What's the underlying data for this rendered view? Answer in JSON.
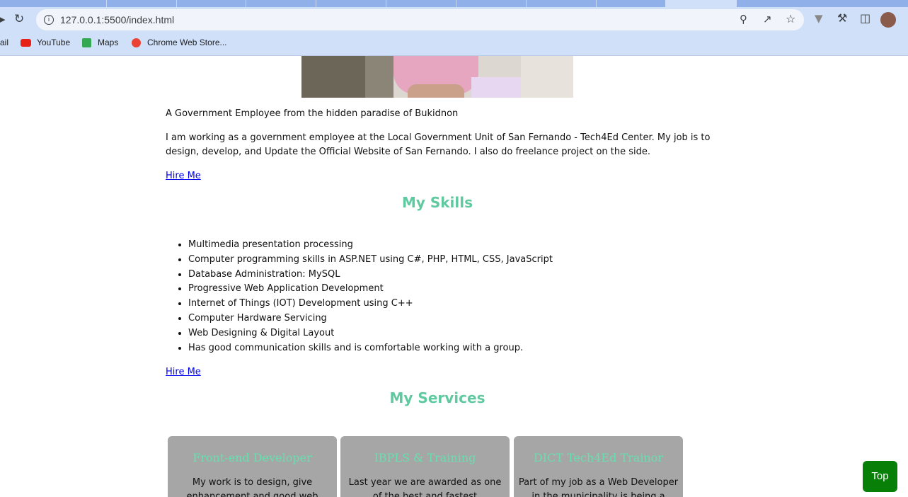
{
  "browser": {
    "url": "127.0.0.1:5500/index.html",
    "bookmarks": [
      "ail",
      "YouTube",
      "Maps",
      "Chrome Web Store..."
    ],
    "colors": {
      "chrome_bg": "#cfe0f8",
      "omnibox_bg": "#f1f5fb"
    }
  },
  "page": {
    "tagline": "A Government Employee from the hidden paradise of Bukidnon",
    "bio": [
      "I am working as a government employee at the Local Government Unit of San Fernando - Tech4Ed Center. My job is to",
      "design, develop, and Update the Official Website of San Fernando. I also do freelance project on the side."
    ],
    "hire_link_1": "Hire Me",
    "skills_heading": "My Skills",
    "skills": [
      "Multimedia presentation processing",
      "Computer programming skills in ASP.NET using C#, PHP, HTML, CSS, JavaScript",
      "Database Administration: MySQL",
      "Progressive Web Application Development",
      "Internet of Things (IOT) Development using C++",
      "Computer Hardware Servicing",
      "Web Designing & Digital Layout",
      "Has good communication skills and is comfortable working with a group."
    ],
    "hire_link_2": "Hire Me",
    "services_heading": "My Services",
    "services": [
      {
        "title": "Front-end Developer",
        "desc": "My work is to design, give enhancement and good web"
      },
      {
        "title": "IBPLS & Training",
        "desc": "Last year we are awarded as one of the best and fastest implementor"
      },
      {
        "title": "DICT Tech4Ed Trainor",
        "desc": "Part of my job as a Web Developer in the municipality is being a"
      }
    ],
    "top_button": "Top",
    "colors": {
      "heading": "#5fc9a0",
      "card_bg": "#a6a6a6",
      "card_title": "#66e0b0",
      "top_button_bg": "#088008",
      "link": "#0000ee"
    }
  }
}
